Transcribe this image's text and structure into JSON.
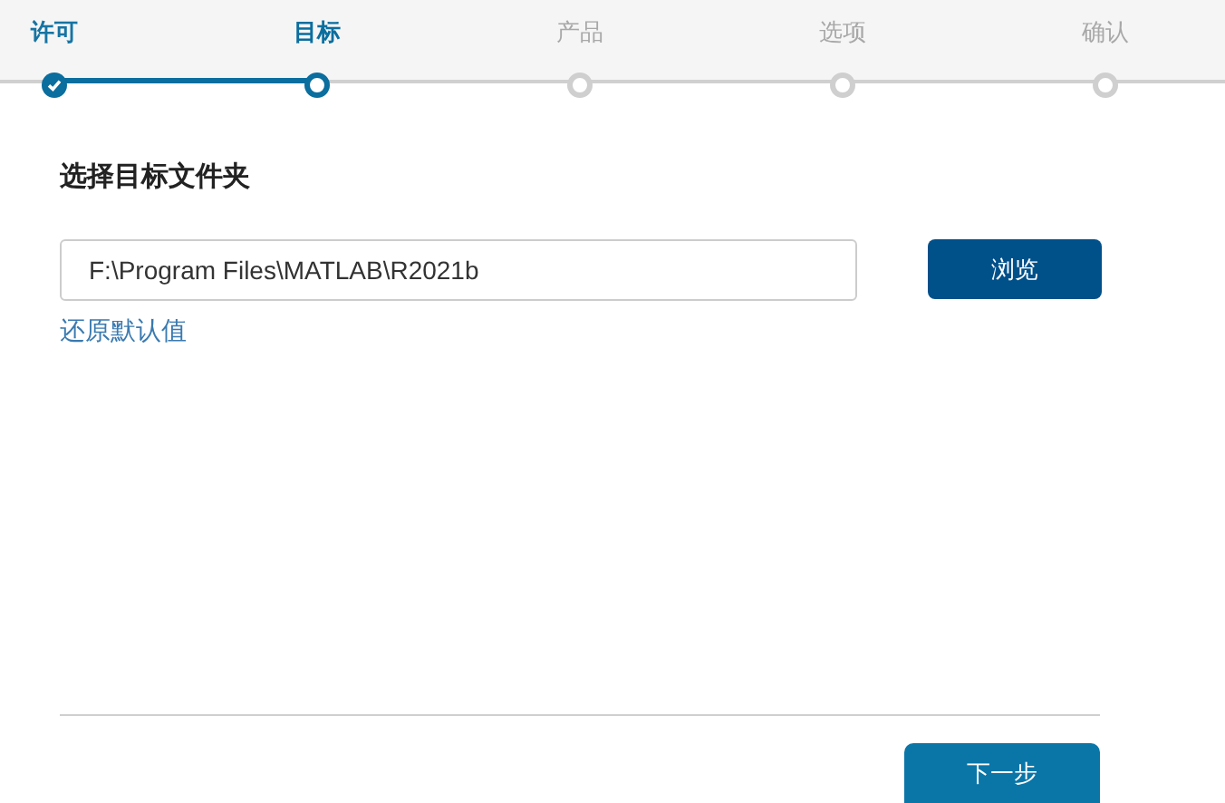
{
  "steps": [
    {
      "label": "许可",
      "completed": true,
      "selected": false
    },
    {
      "label": "目标",
      "completed": false,
      "selected": true
    },
    {
      "label": "产品",
      "completed": false,
      "selected": false
    },
    {
      "label": "选项",
      "completed": false,
      "selected": false
    },
    {
      "label": "确认",
      "completed": false,
      "selected": false
    }
  ],
  "heading": "选择目标文件夹",
  "folder_field": {
    "value": "F:\\Program Files\\MATLAB\\R2021b"
  },
  "browse_button": "浏览",
  "restore_link": "还原默认值",
  "next_button": "下一步"
}
